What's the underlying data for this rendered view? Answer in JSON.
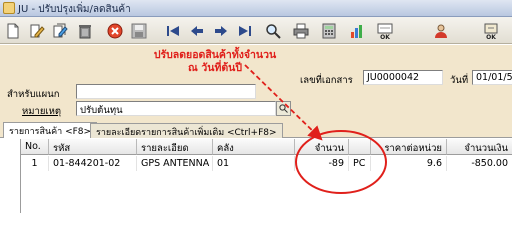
{
  "window": {
    "title": "JU - ปรับปรุงเพิ่ม/ลดสินค้า"
  },
  "toolbar": {
    "buttons": [
      {
        "name": "new-doc-icon",
        "label": ""
      },
      {
        "name": "edit-icon",
        "label": ""
      },
      {
        "name": "edit-multi-icon",
        "label": ""
      },
      {
        "name": "delete-icon",
        "label": ""
      },
      {
        "name": "cancel-icon",
        "label": ""
      },
      {
        "name": "save-icon",
        "label": ""
      },
      {
        "name": "first-record-icon",
        "label": ""
      },
      {
        "name": "previous-record-icon",
        "label": ""
      },
      {
        "name": "next-record-icon",
        "label": ""
      },
      {
        "name": "last-record-icon",
        "label": ""
      },
      {
        "name": "search-icon",
        "label": ""
      },
      {
        "name": "print-icon",
        "label": ""
      },
      {
        "name": "calculator-icon",
        "label": ""
      },
      {
        "name": "chart-icon",
        "label": ""
      },
      {
        "name": "ok-icon",
        "label": "OK"
      },
      {
        "name": "user-icon",
        "label": ""
      },
      {
        "name": "exit-icon",
        "label": "OK"
      }
    ]
  },
  "form": {
    "branch_label": "สำหรับแผนก",
    "remark_label": "หมายเหตุ",
    "remark_value": "ปรับต้นทุน",
    "doc_no_label": "เลขที่เอกสาร",
    "doc_no_value": "JU0000042",
    "date_label": "วันที่",
    "date_value": "01/01/5"
  },
  "annotation": {
    "line1": "ปรับลดยอดสินค้าทั้งจำนวน",
    "line2": "ณ วันที่ต้นปี"
  },
  "tabs": [
    {
      "label": "รายการสินค้า <F8>",
      "active": true
    },
    {
      "label": "รายละเอียดรายการสินค้าเพิ่มเติม <Ctrl+F8>",
      "active": false
    }
  ],
  "grid": {
    "headers": [
      "No.",
      "รหัส",
      "รายละเอียด",
      "คลัง",
      "จำนวน",
      "",
      "ราคาต่อหน่วย",
      "จำนวนเงิน"
    ],
    "rows": [
      {
        "no": "1",
        "code": "01-844201-02",
        "description": "GPS ANTENNA",
        "warehouse": "01",
        "qty": "-89",
        "unit": "PC",
        "unit_price": "9.6",
        "amount": "-850.00"
      }
    ]
  },
  "colors": {
    "form_bg": "#f2e6cc",
    "annotation_red": "#e0201b"
  }
}
